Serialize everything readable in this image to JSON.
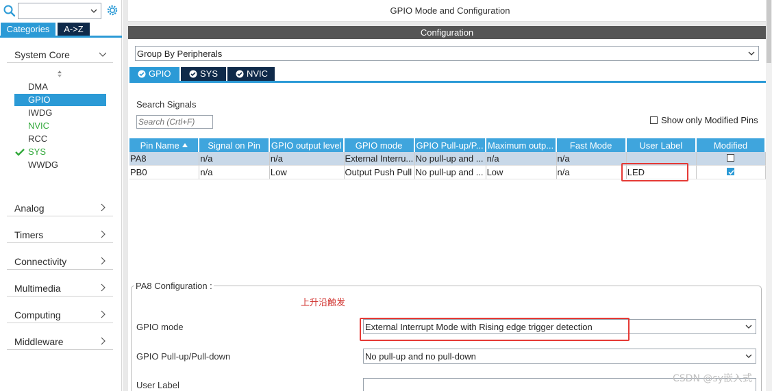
{
  "sidebar": {
    "search_value": "",
    "tabs": [
      {
        "label": "Categories"
      },
      {
        "label": "A->Z"
      }
    ],
    "categories": [
      {
        "label": "System Core",
        "expanded": true
      },
      {
        "label": "Analog"
      },
      {
        "label": "Timers"
      },
      {
        "label": "Connectivity"
      },
      {
        "label": "Multimedia"
      },
      {
        "label": "Computing"
      },
      {
        "label": "Middleware"
      }
    ],
    "system_core_items": [
      {
        "label": "DMA"
      },
      {
        "label": "GPIO",
        "selected": true
      },
      {
        "label": "IWDG"
      },
      {
        "label": "NVIC",
        "color": "#31a83a"
      },
      {
        "label": "RCC"
      },
      {
        "label": "SYS",
        "color": "#31a83a",
        "checked": true
      },
      {
        "label": "WWDG"
      }
    ]
  },
  "main": {
    "title": "GPIO Mode and Configuration",
    "config_header": "Configuration",
    "group_by": "Group By Peripherals",
    "tabs": [
      {
        "label": "GPIO",
        "active": true
      },
      {
        "label": "SYS"
      },
      {
        "label": "NVIC"
      }
    ],
    "search_signals_label": "Search Signals",
    "search_placeholder": "Search (Crtl+F)",
    "show_modified_label": "Show only Modified Pins",
    "table": {
      "headers": [
        "Pin Name",
        "Signal on Pin",
        "GPIO output level",
        "GPIO mode",
        "GPIO Pull-up/P...",
        "Maximum outp...",
        "Fast Mode",
        "User Label",
        "Modified"
      ],
      "rows": [
        {
          "cells": [
            "PA8",
            "n/a",
            "n/a",
            "External Interru...",
            "No pull-up and ...",
            "n/a",
            "n/a",
            ""
          ],
          "modified": false
        },
        {
          "cells": [
            "PB0",
            "n/a",
            "Low",
            "Output Push Pull",
            "No pull-up and ...",
            "Low",
            "n/a",
            "LED"
          ],
          "modified": true
        }
      ]
    },
    "pa8_config": {
      "title": "PA8 Configuration :",
      "annotation": "上升沿触发",
      "gpio_mode_label": "GPIO mode",
      "gpio_mode_value": "External Interrupt Mode with Rising edge trigger detection",
      "pull_label": "GPIO Pull-up/Pull-down",
      "pull_value": "No pull-up and no pull-down",
      "user_label_label": "User Label",
      "user_label_value": ""
    }
  },
  "watermark": "CSDN @sy嵌入式",
  "colors": {
    "accent": "#2b9ad6",
    "dark_tab": "#0f2a4a",
    "header_gray": "#555555",
    "highlight_red": "#e53935",
    "enabled_green": "#31a83a"
  }
}
